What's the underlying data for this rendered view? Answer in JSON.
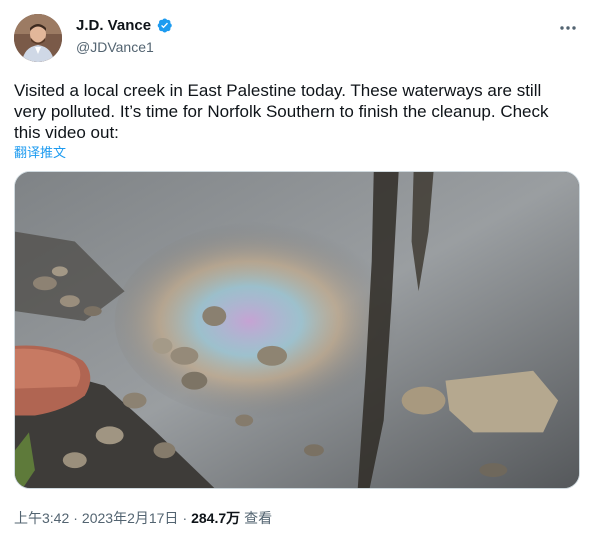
{
  "author": {
    "display_name": "J.D. Vance",
    "handle": "@JDVance1",
    "verified": true
  },
  "tweet": {
    "text": "Visited a local creek in East Palestine today. These waterways are still very polluted. It’s time for Norfolk Southern to finish the cleanup. Check this video out:",
    "translate_label": "翻译推文"
  },
  "meta": {
    "time": "上午3:42",
    "separator": "·",
    "date": "2023年2月17日",
    "separator2": "·",
    "views_count": "284.7万",
    "views_label": "查看"
  },
  "icons": {
    "verified": "verified-badge-icon",
    "more": "more-horizontal-icon"
  },
  "colors": {
    "accent": "#1d9bf0",
    "text": "#0f1419",
    "secondary": "#536471"
  }
}
